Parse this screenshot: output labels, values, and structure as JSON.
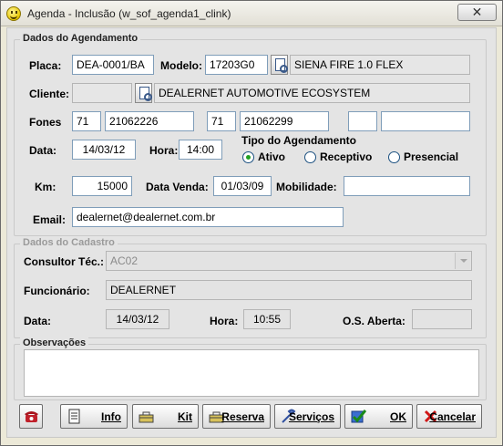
{
  "window": {
    "title": "Agenda - Inclusão (w_sof_agenda1_clink)",
    "close_glyph": "✕"
  },
  "agendamento": {
    "group_title": "Dados do Agendamento",
    "placa_label": "Placa:",
    "placa": "DEA-0001/BA",
    "modelo_label": "Modelo:",
    "modelo_code": "17203G0",
    "modelo_desc": "SIENA FIRE 1.0 FLEX",
    "cliente_label": "Cliente:",
    "cliente_code": "",
    "cliente_name": "DEALERNET AUTOMOTIVE ECOSYSTEM",
    "fones_label": "Fones",
    "fone1_ddd": "71",
    "fone1_num": "21062226",
    "fone2_ddd": "71",
    "fone2_num": "21062299",
    "fone3_ddd": "",
    "fone3_num": "",
    "data_label": "Data:",
    "data": "14/03/12",
    "hora_label": "Hora:",
    "hora": "14:00",
    "tipo_label": "Tipo do Agendamento",
    "tipo_options": [
      "Ativo",
      "Receptivo",
      "Presencial"
    ],
    "tipo_selected": "Ativo",
    "km_label": "Km:",
    "km": "15000",
    "data_venda_label": "Data Venda:",
    "data_venda": "01/03/09",
    "mobilidade_label": "Mobilidade:",
    "mobilidade": "",
    "email_label": "Email:",
    "email": "dealernet@dealernet.com.br"
  },
  "cadastro": {
    "group_title": "Dados do Cadastro",
    "consultor_label": "Consultor Téc.:",
    "consultor": "AC02",
    "funcionario_label": "Funcionário:",
    "funcionario": "DEALERNET",
    "data_label": "Data:",
    "data": "14/03/12",
    "hora_label": "Hora:",
    "hora": "10:55",
    "os_label": "O.S. Aberta:",
    "os": ""
  },
  "observacoes": {
    "group_title": "Observações",
    "text": ""
  },
  "buttons": {
    "info": "Info",
    "kit": "Kit",
    "reserva": "Reserva",
    "servicos": "Serviços",
    "ok": "OK",
    "cancelar": "Cancelar"
  },
  "colors": {
    "radio_checked": "#21a121",
    "field_border": "#7f9db9"
  }
}
